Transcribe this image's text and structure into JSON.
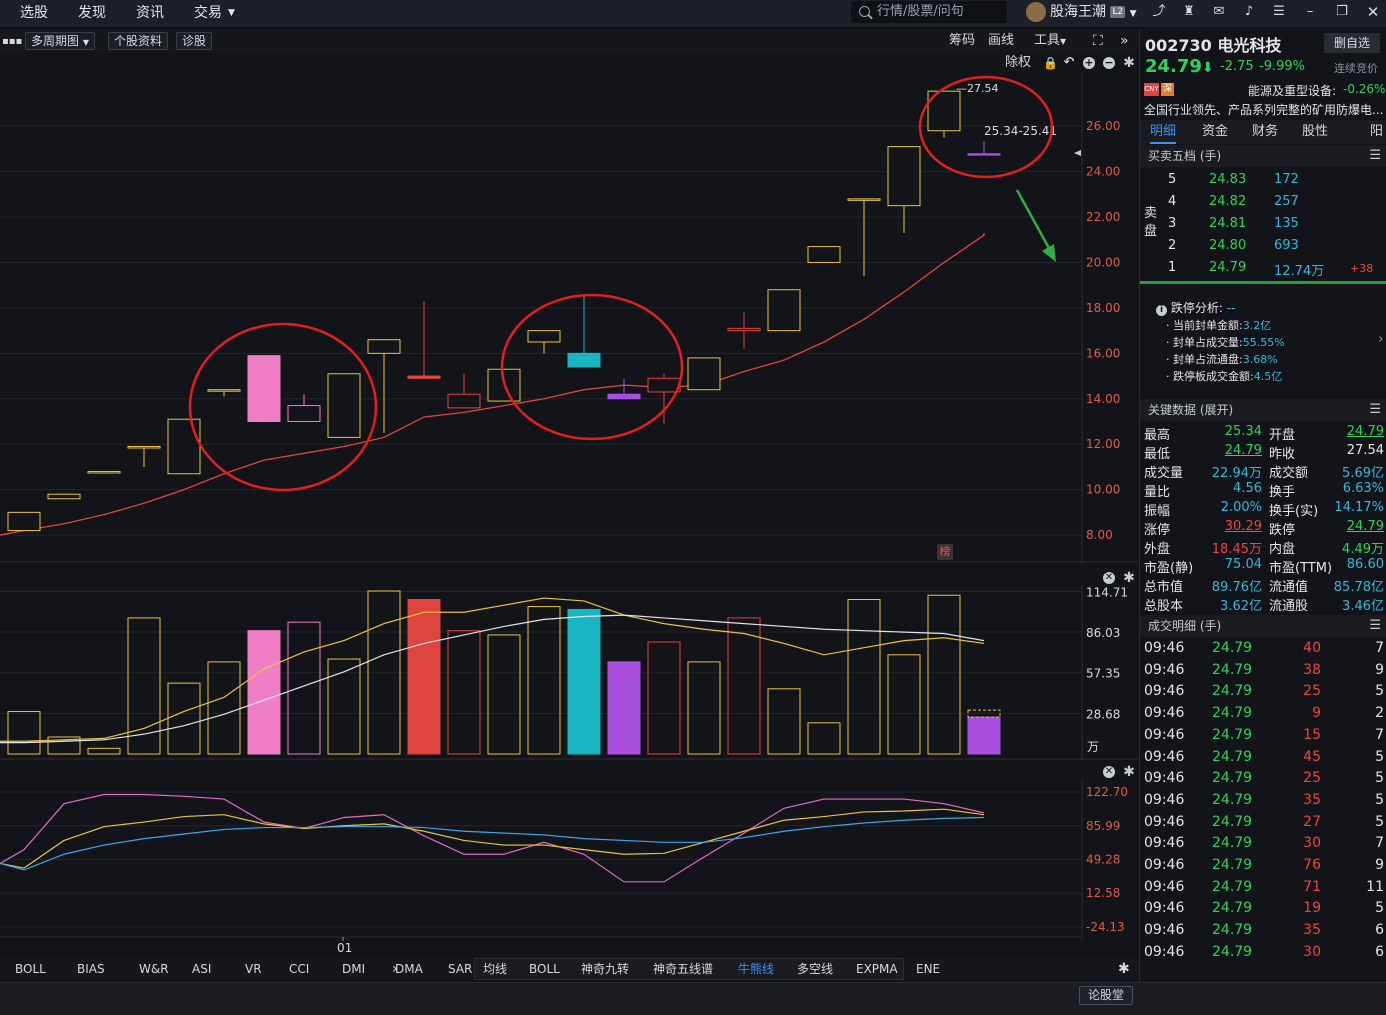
{
  "topnav": [
    "选股",
    "发现",
    "资讯",
    "交易"
  ],
  "search": {
    "placeholder": "行情/股票/问句"
  },
  "user": {
    "name": "股海王潮",
    "level": "L2"
  },
  "toolbar": {
    "period_label": "多周期图",
    "stock_info_label": "个股资料",
    "diagnose_label": "诊股",
    "chips_label": "筹码",
    "draw_label": "画线",
    "tools_label": "工具",
    "exright_label": "除权"
  },
  "chart_data": [
    {
      "type": "candlestick",
      "title": "",
      "y_ticks": [
        "26.00",
        "24.00",
        "22.00",
        "20.00",
        "18.00",
        "16.00",
        "14.00",
        "12.00",
        "10.00",
        "8.00"
      ],
      "ylim": [
        7.3,
        27.9
      ],
      "x_label": "01",
      "candles": [
        {
          "o": 8.2,
          "h": 9.0,
          "l": 8.2,
          "c": 9.0
        },
        {
          "o": 9.6,
          "h": 9.8,
          "l": 9.6,
          "c": 9.8
        },
        {
          "o": 10.8,
          "h": 10.8,
          "l": 10.8,
          "c": 10.8
        },
        {
          "o": 11.9,
          "h": 11.9,
          "l": 11.0,
          "c": 11.9
        },
        {
          "o": 10.7,
          "h": 13.1,
          "l": 10.7,
          "c": 13.1
        },
        {
          "o": 14.4,
          "h": 14.4,
          "l": 14.1,
          "c": 14.4
        },
        {
          "o": 15.9,
          "h": 15.9,
          "l": 13.0,
          "c": 13.0,
          "color": "#f07ec6"
        },
        {
          "o": 13.0,
          "h": 14.2,
          "l": 13.0,
          "c": 13.7,
          "color": "#f07ec6",
          "hollow": true
        },
        {
          "o": 12.3,
          "h": 15.1,
          "l": 12.3,
          "c": 15.1
        },
        {
          "o": 16.0,
          "h": 16.6,
          "l": 12.5,
          "c": 16.6
        },
        {
          "o": 14.9,
          "h": 18.3,
          "l": 14.9,
          "c": 15.0,
          "color": "#e0443f"
        },
        {
          "o": 13.6,
          "h": 15.1,
          "l": 13.6,
          "c": 14.2,
          "color": "#e0443f",
          "hollow": true
        },
        {
          "o": 13.9,
          "h": 15.3,
          "l": 13.9,
          "c": 15.3
        },
        {
          "o": 16.5,
          "h": 17.0,
          "l": 16.0,
          "c": 17.0
        },
        {
          "o": 16.0,
          "h": 18.6,
          "l": 15.4,
          "c": 15.4,
          "color": "#19b5c2"
        },
        {
          "o": 14.0,
          "h": 14.9,
          "l": 14.0,
          "c": 14.2,
          "color": "#a84fe0"
        },
        {
          "o": 14.3,
          "h": 15.1,
          "l": 12.9,
          "c": 14.9,
          "color": "#e0443f",
          "hollow": true
        },
        {
          "o": 14.4,
          "h": 15.8,
          "l": 14.4,
          "c": 15.8
        },
        {
          "o": 17.1,
          "h": 17.8,
          "l": 16.2,
          "c": 17.0,
          "color": "#e0443f",
          "hollow": true
        },
        {
          "o": 17.0,
          "h": 18.8,
          "l": 17.0,
          "c": 18.8
        },
        {
          "o": 20.0,
          "h": 20.7,
          "l": 20.0,
          "c": 20.7
        },
        {
          "o": 22.8,
          "h": 22.8,
          "l": 19.4,
          "c": 22.8
        },
        {
          "o": 22.5,
          "h": 25.1,
          "l": 21.3,
          "c": 25.1
        },
        {
          "o": 25.8,
          "h": 27.54,
          "l": 25.5,
          "c": 27.54
        },
        {
          "o": 24.79,
          "h": 25.34,
          "l": 24.79,
          "c": 24.79,
          "color": "#a84fe0"
        }
      ],
      "ma_line": [
        8.2,
        8.5,
        8.9,
        9.4,
        10.0,
        10.7,
        11.3,
        11.6,
        11.9,
        12.3,
        13.2,
        13.4,
        13.7,
        14.0,
        14.4,
        14.6,
        14.5,
        14.6,
        15.2,
        15.7,
        16.5,
        17.5,
        18.7,
        20.0,
        21.2
      ],
      "annotations": {
        "high_label": "27.54",
        "range_label": "25.34-25.41"
      }
    },
    {
      "type": "bar",
      "title": "",
      "unit": "万",
      "y_ticks": [
        "114.71",
        "86.03",
        "57.35",
        "28.68"
      ],
      "ylim": [
        0,
        115
      ],
      "values": [
        30,
        12,
        4,
        96,
        50,
        65,
        87,
        93,
        67,
        115,
        109,
        87,
        84,
        104,
        102,
        65,
        79,
        65,
        96,
        46,
        22,
        109,
        70,
        112,
        26
      ],
      "ma5": [
        9,
        10,
        11,
        18,
        30,
        40,
        60,
        72,
        80,
        92,
        100,
        100,
        105,
        110,
        108,
        98,
        92,
        88,
        85,
        78,
        70,
        75,
        80,
        82,
        78
      ],
      "ma10": [
        8,
        9,
        10,
        14,
        20,
        28,
        38,
        48,
        58,
        70,
        78,
        84,
        90,
        95,
        97,
        98,
        96,
        94,
        92,
        90,
        88,
        87,
        86,
        85,
        80
      ]
    },
    {
      "type": "line",
      "title": "",
      "y_ticks": [
        "122.70",
        "85.99",
        "49.28",
        "12.58",
        "-24.13"
      ],
      "ylim": [
        -24.13,
        122.7
      ],
      "series": [
        {
          "color": "#e26bc2",
          "values": [
            60,
            110,
            120,
            120,
            118,
            115,
            90,
            83,
            95,
            98,
            75,
            55,
            55,
            68,
            55,
            25,
            25,
            52,
            78,
            105,
            115,
            115,
            115,
            110,
            100
          ]
        },
        {
          "color": "#e8c342",
          "values": [
            40,
            70,
            85,
            90,
            96,
            98,
            88,
            83,
            86,
            88,
            80,
            70,
            65,
            65,
            60,
            55,
            56,
            68,
            80,
            92,
            96,
            101,
            102,
            104,
            98
          ]
        },
        {
          "color": "#3ba7ea",
          "values": [
            38,
            55,
            65,
            72,
            77,
            82,
            84,
            84,
            85,
            85,
            84,
            80,
            78,
            76,
            72,
            70,
            68,
            68,
            73,
            80,
            85,
            89,
            92,
            94,
            95
          ]
        }
      ]
    }
  ],
  "indicator_tabs": [
    "BOLL",
    "BIAS",
    "W&R",
    "ASI",
    "VR",
    "CCI",
    "DMI",
    "DMA",
    "SAR"
  ],
  "overlay_tabs": [
    "均线",
    "BOLL",
    "神奇九转",
    "神奇五线谱",
    "牛熊线",
    "多空线",
    "EXPMA",
    "ENE"
  ],
  "overlay_active": "牛熊线",
  "status": {
    "lun_gu_label": "论股堂"
  },
  "stock": {
    "code": "002730",
    "name": "电光科技",
    "add_label": "删自选",
    "price": "24.79",
    "change": "-2.75",
    "change_pct": "-9.99%",
    "bid_status": "连续竞价",
    "tag_cny": "CNY",
    "tag_sz": "深",
    "industry": "能源及重型设备:",
    "industry_change": "-0.26%",
    "description": "全国行业领先、产品系列完整的矿用防爆电..."
  },
  "detail_tabs": [
    "明细",
    "资金",
    "财务",
    "股性",
    "阳"
  ],
  "orderbook": {
    "title": "买卖五档 (手)",
    "side_label": "卖\n盘",
    "rows": [
      {
        "level": "5",
        "price": "24.83",
        "vol": "172",
        "diff": ""
      },
      {
        "level": "4",
        "price": "24.82",
        "vol": "257",
        "diff": ""
      },
      {
        "level": "3",
        "price": "24.81",
        "vol": "135",
        "diff": ""
      },
      {
        "level": "2",
        "price": "24.80",
        "vol": "693",
        "diff": ""
      },
      {
        "level": "1",
        "price": "24.79",
        "vol": "12.74万",
        "diff": "+38"
      }
    ]
  },
  "limit_analysis": {
    "title": "跌停分析:",
    "title_value": "--",
    "items": [
      {
        "label": "当前封单金额:",
        "value": "3.2亿"
      },
      {
        "label": "封单占成交量:",
        "value": "55.55%"
      },
      {
        "label": "封单占流通盘:",
        "value": "3.68%"
      },
      {
        "label": "跌停板成交金额:",
        "value": "4.5亿"
      }
    ]
  },
  "key_data": {
    "title": "关键数据 (展开)",
    "rows": [
      [
        {
          "label": "最高",
          "value": "25.34",
          "color": "g"
        },
        {
          "label": "开盘",
          "value": "24.79",
          "color": "g"
        }
      ],
      [
        {
          "label": "最低",
          "value": "24.79",
          "color": "g"
        },
        {
          "label": "昨收",
          "value": "27.54",
          "color": "w"
        }
      ],
      [
        {
          "label": "成交量",
          "value": "22.94万",
          "color": "c"
        },
        {
          "label": "成交额",
          "value": "5.69亿",
          "color": "c"
        }
      ],
      [
        {
          "label": "量比",
          "value": "4.56",
          "color": "c"
        },
        {
          "label": "换手",
          "value": "6.63%",
          "color": "c"
        }
      ],
      [
        {
          "label": "振幅",
          "value": "2.00%",
          "color": "c"
        },
        {
          "label": "换手(实)",
          "value": "14.17%",
          "color": "c"
        }
      ],
      [
        {
          "label": "涨停",
          "value": "30.29",
          "color": "r"
        },
        {
          "label": "跌停",
          "value": "24.79",
          "color": "g"
        }
      ],
      [
        {
          "label": "外盘",
          "value": "18.45万",
          "color": "r"
        },
        {
          "label": "内盘",
          "value": "4.49万",
          "color": "g"
        }
      ],
      [
        {
          "label": "市盈(静)",
          "value": "75.04",
          "color": "c"
        },
        {
          "label": "市盈(TTM)",
          "value": "86.60",
          "color": "c"
        }
      ],
      [
        {
          "label": "总市值",
          "value": "89.76亿",
          "color": "c"
        },
        {
          "label": "流通值",
          "value": "85.78亿",
          "color": "c"
        }
      ],
      [
        {
          "label": "总股本",
          "value": "3.62亿",
          "color": "c"
        },
        {
          "label": "流通股",
          "value": "3.46亿",
          "color": "c"
        }
      ]
    ]
  },
  "trades": {
    "title": "成交明细 (手)",
    "rows": [
      {
        "time": "09:46",
        "price": "24.79",
        "vol": "40",
        "n": "7"
      },
      {
        "time": "09:46",
        "price": "24.79",
        "vol": "38",
        "n": "9"
      },
      {
        "time": "09:46",
        "price": "24.79",
        "vol": "25",
        "n": "5"
      },
      {
        "time": "09:46",
        "price": "24.79",
        "vol": "9",
        "n": "2"
      },
      {
        "time": "09:46",
        "price": "24.79",
        "vol": "15",
        "n": "7"
      },
      {
        "time": "09:46",
        "price": "24.79",
        "vol": "45",
        "n": "5"
      },
      {
        "time": "09:46",
        "price": "24.79",
        "vol": "25",
        "n": "5"
      },
      {
        "time": "09:46",
        "price": "24.79",
        "vol": "35",
        "n": "5"
      },
      {
        "time": "09:46",
        "price": "24.79",
        "vol": "27",
        "n": "5"
      },
      {
        "time": "09:46",
        "price": "24.79",
        "vol": "30",
        "n": "7"
      },
      {
        "time": "09:46",
        "price": "24.79",
        "vol": "76",
        "n": "9"
      },
      {
        "time": "09:46",
        "price": "24.79",
        "vol": "71",
        "n": "11"
      },
      {
        "time": "09:46",
        "price": "24.79",
        "vol": "19",
        "n": "5"
      },
      {
        "time": "09:46",
        "price": "24.79",
        "vol": "35",
        "n": "6"
      },
      {
        "time": "09:46",
        "price": "24.79",
        "vol": "30",
        "n": "6"
      }
    ]
  }
}
